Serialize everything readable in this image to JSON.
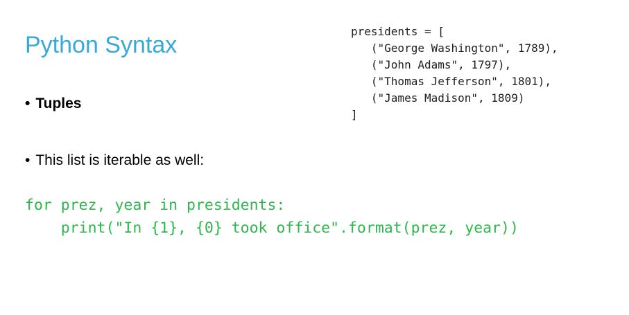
{
  "slide": {
    "title": "Python Syntax",
    "code_block": {
      "lines": [
        "presidents = [",
        "   (\"George Washington\", 1789),",
        "   (\"John Adams\", 1797),",
        "   (\"Thomas Jefferson\", 1801),",
        "   (\"James Madison\", 1809)",
        "]"
      ]
    },
    "bullets": [
      {
        "marker": "•",
        "text": "Tuples"
      },
      {
        "marker": "•",
        "text": "This list is iterable as well:"
      }
    ],
    "loop_code": {
      "lines": [
        "for prez, year in presidents:",
        "    print(\"In {1}, {0} took office\".format(prez, year))"
      ]
    },
    "colors": {
      "title": "#3aa8d8",
      "loop_code": "#2db84d",
      "code_block": "#1e1e1e"
    }
  }
}
